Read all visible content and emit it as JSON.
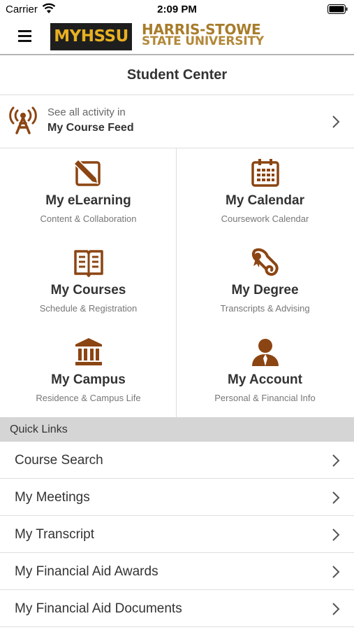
{
  "status_bar": {
    "carrier": "Carrier",
    "time": "2:09 PM"
  },
  "header": {
    "logo_badge": "MYHSSU",
    "logo_line1": "HARRIS-STOWE",
    "logo_line2": "STATE UNIVERSITY",
    "menu_icon": "hamburger-menu-icon"
  },
  "page_title": "Student Center",
  "course_feed": {
    "subtitle": "See all activity in",
    "title": "My Course Feed",
    "icon": "broadcast-tower-icon"
  },
  "colors": {
    "accent": "#8b4513",
    "logo_gold": "#e8b021",
    "logo_text": "#a87c2b",
    "quick_links_bg": "#d5d5d5"
  },
  "tiles": [
    {
      "title": "My eLearning",
      "subtitle": "Content & Collaboration",
      "icon": "pencil-square-icon"
    },
    {
      "title": "My Calendar",
      "subtitle": "Coursework Calendar",
      "icon": "calendar-icon"
    },
    {
      "title": "My Courses",
      "subtitle": "Schedule & Registration",
      "icon": "open-book-icon"
    },
    {
      "title": "My Degree",
      "subtitle": "Transcripts & Advising",
      "icon": "diploma-scroll-icon"
    },
    {
      "title": "My Campus",
      "subtitle": "Residence & Campus Life",
      "icon": "institution-icon"
    },
    {
      "title": "My Account",
      "subtitle": "Personal & Financial Info",
      "icon": "user-icon"
    }
  ],
  "quick_links": {
    "header": "Quick Links",
    "items": [
      {
        "label": "Course Search"
      },
      {
        "label": "My Meetings"
      },
      {
        "label": "My Transcript"
      },
      {
        "label": "My Financial Aid Awards"
      },
      {
        "label": "My Financial Aid Documents"
      }
    ]
  }
}
